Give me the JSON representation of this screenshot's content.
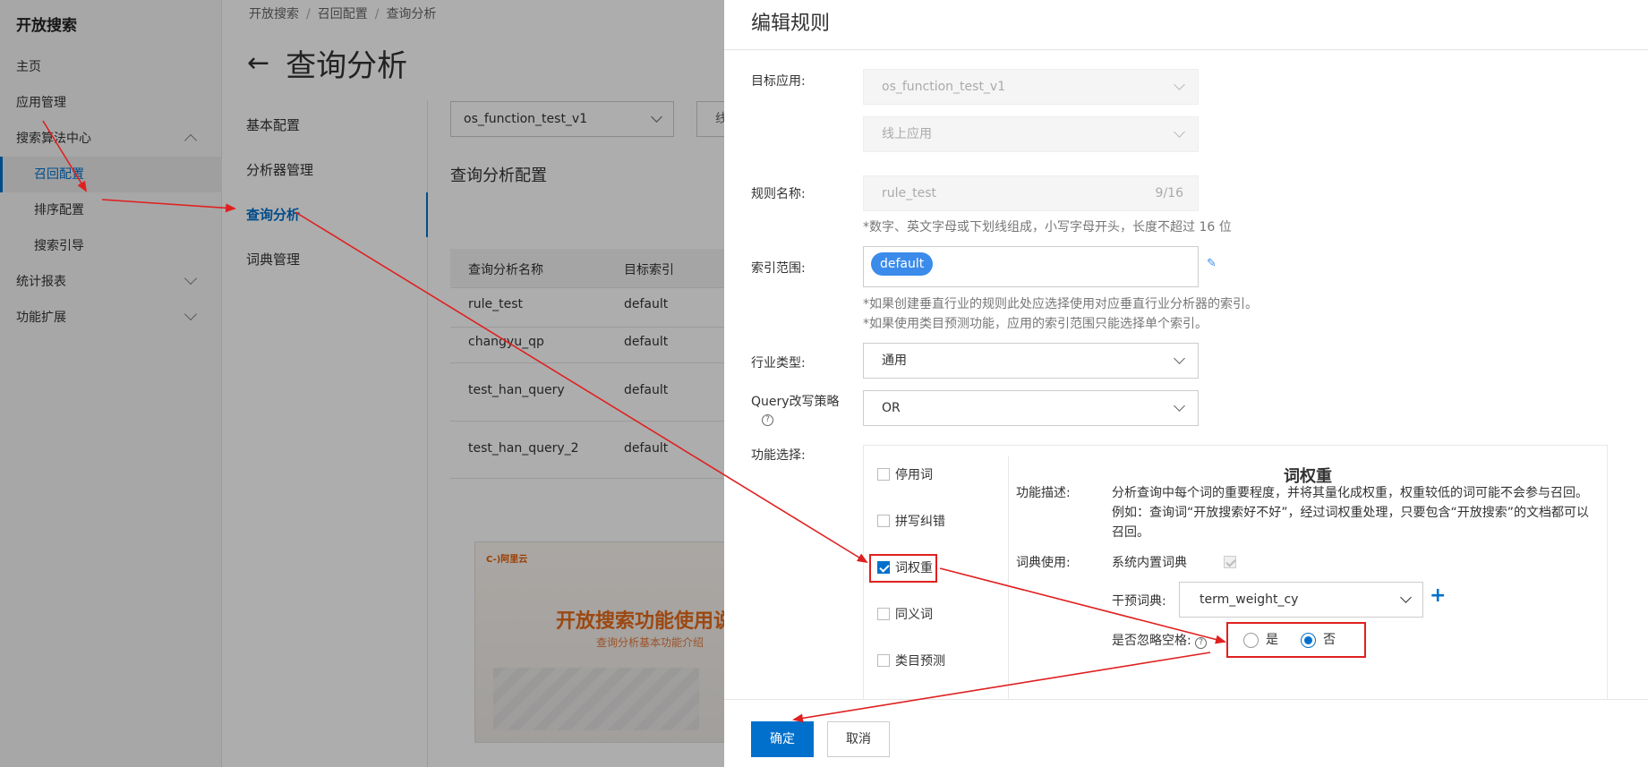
{
  "leftnav": {
    "brand": "开放搜索",
    "items": [
      {
        "label": "主页"
      },
      {
        "label": "应用管理"
      },
      {
        "label": "搜索算法中心"
      },
      {
        "label": "召回配置"
      },
      {
        "label": "排序配置"
      },
      {
        "label": "搜索引导"
      },
      {
        "label": "统计报表"
      },
      {
        "label": "功能扩展"
      }
    ]
  },
  "content": {
    "breadcrumb": [
      "开放搜索",
      "召回配置",
      "查询分析"
    ],
    "page_title": "查询分析",
    "subnav": [
      "基本配置",
      "分析器管理",
      "查询分析",
      "词典管理"
    ],
    "app_select": "os_function_test_v1",
    "app_select2": "线",
    "section_title": "查询分析配置",
    "table": {
      "headers": [
        "查询分析名称",
        "目标索引"
      ],
      "rows": [
        [
          "rule_test",
          "default"
        ],
        [
          "changyu_qp",
          "default"
        ],
        [
          "test_han_query",
          "default"
        ],
        [
          "test_han_query_2",
          "default"
        ]
      ]
    },
    "promo": {
      "logo": "C-)阿里云",
      "big": "开放搜索功能使用说",
      "small": "查询分析基本功能介绍"
    }
  },
  "drawer": {
    "title": "编辑规则",
    "target_app_label": "目标应用:",
    "target_app_value": "os_function_test_v1",
    "target_version_value": "线上应用",
    "rule_name_label": "规则名称:",
    "rule_name_value": "rule_test",
    "rule_name_counter": "9/16",
    "rule_name_hint": "*数字、英文字母或下划线组成，小写字母开头，长度不超过 16 位",
    "index_label": "索引范围:",
    "index_tag": "default",
    "index_hint1": "*如果创建垂直行业的规则此处应选择使用对应垂直行业分析器的索引。",
    "index_hint2": "*如果使用类目预测功能，应用的索引范围只能选择单个索引。",
    "industry_label": "行业类型:",
    "industry_value": "通用",
    "query_rewrite_label": "Query改写策略",
    "query_rewrite_value": "OR",
    "feature_label": "功能选择:",
    "features": [
      {
        "label": "停用词",
        "checked": false
      },
      {
        "label": "拼写纠错",
        "checked": false
      },
      {
        "label": "词权重",
        "checked": true
      },
      {
        "label": "同义词",
        "checked": false
      },
      {
        "label": "类目预测",
        "checked": false
      }
    ],
    "detail": {
      "title": "词权重",
      "desc_label": "功能描述:",
      "desc": "分析查询中每个词的重要程度，并将其量化成权重，权重较低的词可能不会参与召回。例如：查询词“开放搜索好不好”，经过词权重处理，只要包含“开放搜索”的文档都可以召回。",
      "dict_label": "词典使用:",
      "builtin_dict": "系统内置词典",
      "intervene_label": "干预词典:",
      "intervene_value": "term_weight_cy",
      "ignore_space_label": "是否忽略空格:",
      "yes": "是",
      "no": "否"
    },
    "confirm": "确定",
    "cancel": "取消"
  },
  "colors": {
    "accent": "#0070cc",
    "annotation": "#e02020",
    "tag": "#3b8bea"
  }
}
